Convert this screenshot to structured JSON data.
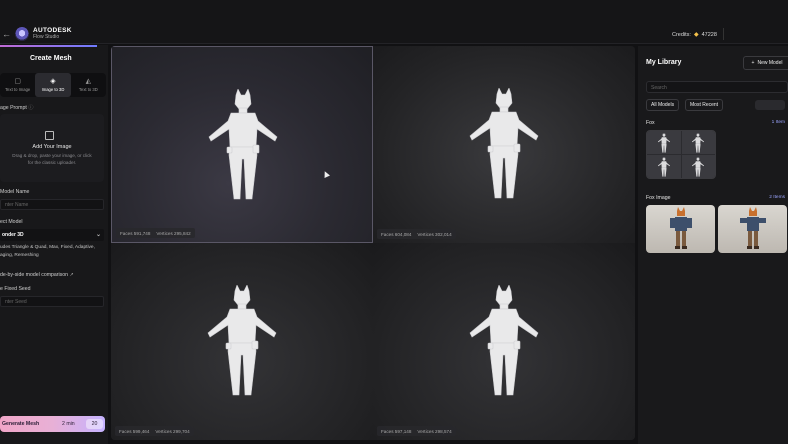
{
  "header": {
    "brand": "AUTODESK",
    "product": "Flow Studio",
    "credits_label": "Credits:",
    "credits_value": "47228"
  },
  "sidebar": {
    "title": "Create Mesh",
    "modes": [
      {
        "label": "Text to Image",
        "icon": "image-icon"
      },
      {
        "label": "Image to 3D",
        "icon": "cube-icon"
      },
      {
        "label": "Text to 3D",
        "icon": "cube-text-icon"
      }
    ],
    "image_prompt_label": "age Prompt",
    "upload_title": "Add Your Image",
    "upload_hint": "Drag & drop, paste your image, or click for the classic uploader.",
    "model_name_label": "Model Name",
    "model_name_placeholder": "nter Name",
    "select_model_label": "ect Model",
    "selected_model": "onder 3D",
    "model_description": "udes Triangle & Quad, Max, Fixed, Adaptive, aging, Remeshing",
    "comparison_link": "de-by-side model comparison",
    "seed_label": "e Fixed Seed",
    "seed_placeholder": "nter Seed",
    "generate_label": "Generate Mesh",
    "generate_time": "2 min",
    "generate_cost": "20"
  },
  "viewport": {
    "cells": [
      {
        "faces": "Faces 591,748",
        "vertices": "Vertices 295,842"
      },
      {
        "faces": "Faces 604,084",
        "vertices": "Vertices 302,014"
      },
      {
        "faces": "Faces 599,464",
        "vertices": "Vertices 299,704"
      },
      {
        "faces": "Faces 597,148",
        "vertices": "Vertices 298,574"
      }
    ]
  },
  "library": {
    "title": "My Library",
    "new_model": "New Model",
    "search_placeholder": "Search",
    "filter_all": "All Models",
    "filter_recent": "Most Recent",
    "groups": [
      {
        "name": "Fox",
        "count": "1 Item"
      },
      {
        "name": "Fox Image",
        "count": "2 Items"
      }
    ]
  },
  "colors": {
    "accent_gradient_start": "#f0a6c8",
    "accent_gradient_end": "#c5b2ff",
    "credits_gem": "#f3c04a",
    "link": "#9aa4ff"
  }
}
